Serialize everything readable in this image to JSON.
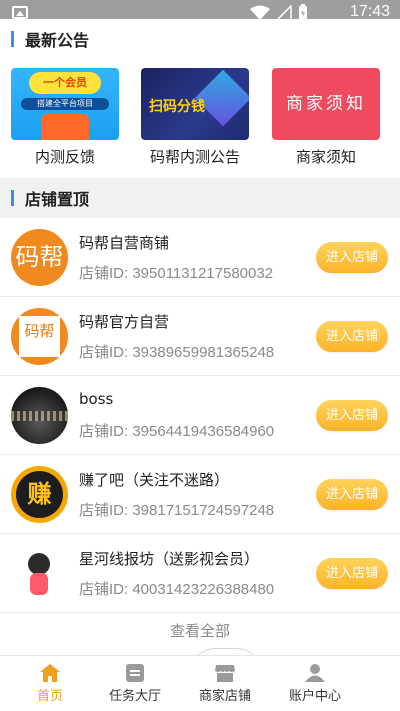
{
  "status_bar": {
    "time": "17:43",
    "left_icon": "image-icon",
    "icons": [
      "wifi-icon",
      "signal-icon",
      "battery-icon"
    ]
  },
  "announcements": {
    "title": "最新公告",
    "items": [
      {
        "label": "内测反馈",
        "image_text": [
          "一个会员",
          "搭建全平台项目"
        ]
      },
      {
        "label": "码帮内测公告",
        "image_text": [
          "扫码分钱"
        ]
      },
      {
        "label": "商家须知",
        "image_text": [
          "商家须知"
        ]
      }
    ]
  },
  "shops": {
    "title": "店铺置顶",
    "enter_label": "进入店铺",
    "items": [
      {
        "name": "码帮自营商铺",
        "id": "店铺ID: 39501131217580032",
        "logo_text": "码帮"
      },
      {
        "name": "码帮官方自营",
        "id": "店铺ID: 39389659981365248",
        "logo_text": "码帮"
      },
      {
        "name": "boss",
        "id": "店铺ID: 39564419436584960",
        "logo_text": ""
      },
      {
        "name": "赚了吧（关注不迷路）",
        "id": "店铺ID: 39817151724597248",
        "logo_text": "赚"
      },
      {
        "name": "星河线报坊（送影视会员）",
        "id": "店铺ID: 40031423226388480",
        "logo_text": ""
      }
    ],
    "view_all": "查看全部"
  },
  "bottom_nav": {
    "items": [
      {
        "label": "首页",
        "icon": "home-icon",
        "active": true
      },
      {
        "label": "任务大厅",
        "icon": "task-icon",
        "active": false
      },
      {
        "label": "商家店铺",
        "icon": "store-icon",
        "active": false
      },
      {
        "label": "账户中心",
        "icon": "user-icon",
        "active": false
      }
    ]
  },
  "colors": {
    "accent": "#f0a020",
    "section_bar": "#3a8ee6",
    "enter_button": "#fbb32a"
  }
}
